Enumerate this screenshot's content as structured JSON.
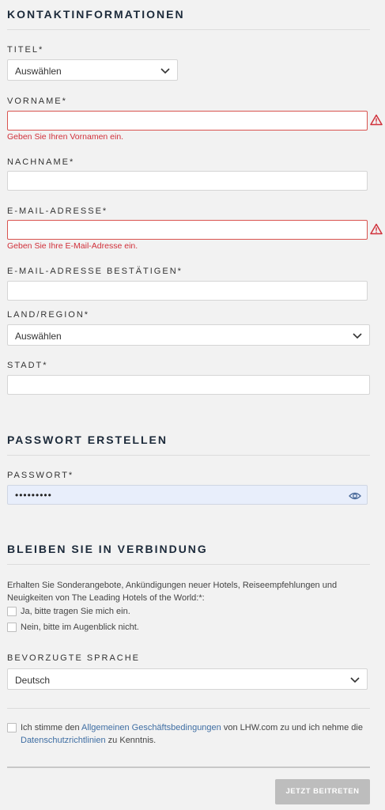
{
  "contact": {
    "title": "KONTAKTINFORMATIONEN",
    "titel_label": "TITEL*",
    "titel_value": "Auswählen",
    "vorname_label": "VORNAME*",
    "vorname_error": "Geben Sie Ihren Vornamen ein.",
    "nachname_label": "NACHNAME*",
    "email_label": "E-MAIL-ADRESSE*",
    "email_error": "Geben Sie Ihre E-Mail-Adresse ein.",
    "email_confirm_label": "E-MAIL-ADRESSE BESTÄTIGEN*",
    "country_label": "LAND/REGION*",
    "country_value": "Auswählen",
    "city_label": "STADT*"
  },
  "password": {
    "title": "PASSWORT ERSTELLEN",
    "label": "PASSWORT*",
    "value": "•••••••••"
  },
  "connect": {
    "title": "BLEIBEN SIE IN VERBINDUNG",
    "description": "Erhalten Sie Sonderangebote, Ankündigungen neuer Hotels, Reiseempfehlungen und Neuigkeiten von The Leading Hotels of the World:*:",
    "option_yes": "Ja, bitte tragen Sie mich ein.",
    "option_no": "Nein, bitte im Augenblick nicht.",
    "language_label": "BEVORZUGTE SPRACHE",
    "language_value": "Deutsch"
  },
  "terms": {
    "prefix": "Ich stimme den ",
    "link1": "Allgemeinen Geschäftsbedingungen",
    "middle": " von LHW.com zu und ich nehme die ",
    "link2": "Datenschutzrichtlinien",
    "suffix": " zu Kenntnis."
  },
  "submit_label": "JETZT BEITRETEN",
  "colors": {
    "error": "#d0303a",
    "link": "#3f6ea3",
    "button_disabled": "#bdbdbd",
    "password_bg": "#e8eefb"
  },
  "icons": [
    "chevron-down-icon",
    "warning-icon",
    "eye-icon"
  ]
}
